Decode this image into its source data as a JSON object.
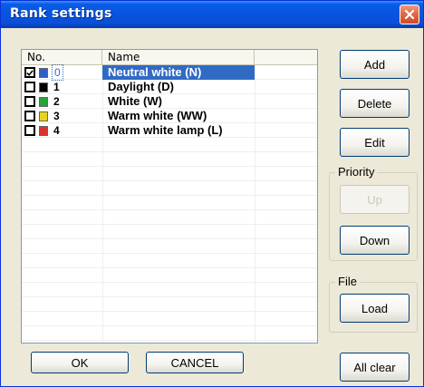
{
  "window": {
    "title": "Rank settings",
    "close_icon": "close-icon"
  },
  "list": {
    "columns": [
      "No.",
      "Name",
      ""
    ],
    "rows": [
      {
        "checked": true,
        "color": "#2f5fc8",
        "index": "0",
        "name": "Neutral white (N)",
        "selected": true
      },
      {
        "checked": false,
        "color": "#000000",
        "index": "1",
        "name": "Daylight (D)",
        "selected": false
      },
      {
        "checked": false,
        "color": "#27a33a",
        "index": "2",
        "name": "White (W)",
        "selected": false
      },
      {
        "checked": false,
        "color": "#e8d51a",
        "index": "3",
        "name": "Warm white (WW)",
        "selected": false
      },
      {
        "checked": false,
        "color": "#d9342b",
        "index": "4",
        "name": "Warm white lamp (L)",
        "selected": false
      }
    ]
  },
  "buttons": {
    "add": "Add",
    "delete": "Delete",
    "edit": "Edit",
    "up": "Up",
    "down": "Down",
    "load": "Load",
    "ok": "OK",
    "cancel": "CANCEL",
    "all_clear": "All clear"
  },
  "groups": {
    "priority": "Priority",
    "file": "File"
  }
}
